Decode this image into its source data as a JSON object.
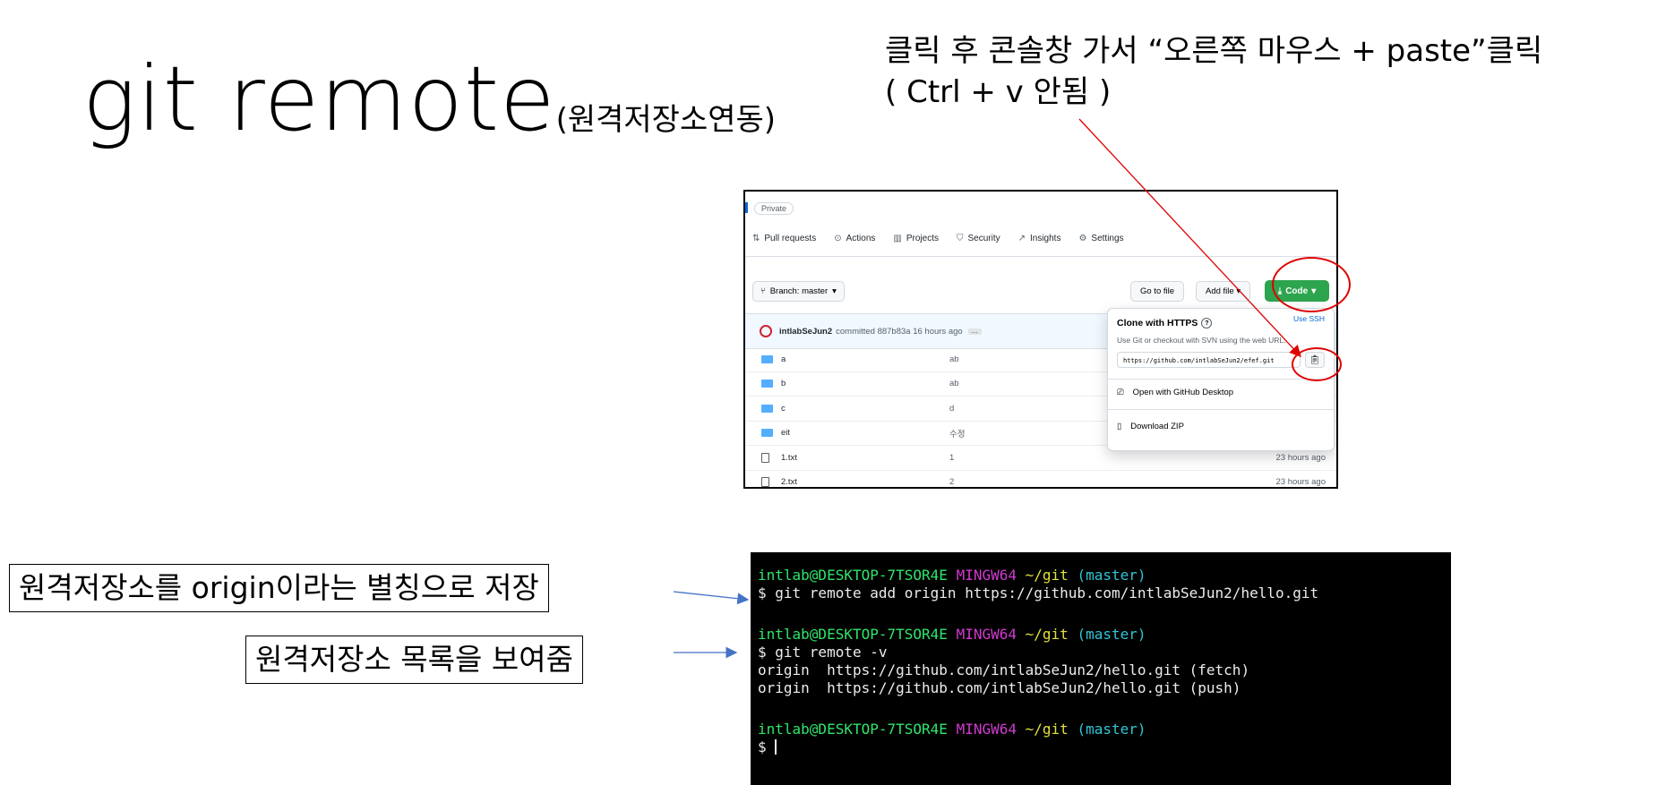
{
  "title": {
    "main": "git remote",
    "sub": "(원격저장소연동)"
  },
  "instruction": {
    "line1": "클릭 후 콘솔창 가서 “오른쪽 마우스 + paste”클릭",
    "line2": "( Ctrl + v 안됨 )"
  },
  "github": {
    "private_badge": "Private",
    "tabs": [
      {
        "icon": "pull-request-icon",
        "label": "Pull requests"
      },
      {
        "icon": "play-icon",
        "label": "Actions"
      },
      {
        "icon": "project-icon",
        "label": "Projects"
      },
      {
        "icon": "shield-icon",
        "label": "Security"
      },
      {
        "icon": "graph-icon",
        "label": "Insights"
      },
      {
        "icon": "gear-icon",
        "label": "Settings"
      }
    ],
    "branch_label": "Branch: master",
    "goto_file": "Go to file",
    "add_file": "Add file",
    "code": "Code",
    "commit": {
      "author": "intlabSeJun2",
      "message": "committed 887b83a 16 hours ago",
      "ellipsis": "…"
    },
    "files": [
      {
        "type": "folder",
        "name": "a",
        "message": "ab",
        "time": ""
      },
      {
        "type": "folder",
        "name": "b",
        "message": "ab",
        "time": ""
      },
      {
        "type": "folder",
        "name": "c",
        "message": "d",
        "time": ""
      },
      {
        "type": "folder",
        "name": "eit",
        "message": "수정",
        "time": ""
      },
      {
        "type": "file",
        "name": "1.txt",
        "message": "1",
        "time": "23 hours ago"
      },
      {
        "type": "file",
        "name": "2.txt",
        "message": "2",
        "time": "23 hours ago"
      }
    ],
    "dropdown": {
      "title": "Clone with HTTPS",
      "use_ssh": "Use SSH",
      "hint": "Use Git or checkout with SVN using the web URL.",
      "url": "https://github.com/intlabSeJun2/efef.git",
      "open_desktop": "Open with GitHub Desktop",
      "download_zip": "Download ZIP"
    }
  },
  "labels": {
    "origin_alias": "원격저장소를 origin이라는 별칭으로 저장",
    "remote_list": "원격저장소 목록을 보여줌"
  },
  "terminal": {
    "prompt_user": "intlab@DESKTOP-7TSOR4E",
    "prompt_env": "MINGW64",
    "prompt_path": "~/git",
    "prompt_branch": "(master)",
    "cmd1": "$ git remote add origin https://github.com/intlabSeJun2/hello.git",
    "cmd2": "$ git remote -v",
    "out1": "origin  https://github.com/intlabSeJun2/hello.git (fetch)",
    "out2": "origin  https://github.com/intlabSeJun2/hello.git (push)",
    "prompt_last": "$ "
  },
  "colors": {
    "arrow_red": "#e00000",
    "arrow_blue": "#4472c4",
    "code_green": "#2da44e"
  }
}
